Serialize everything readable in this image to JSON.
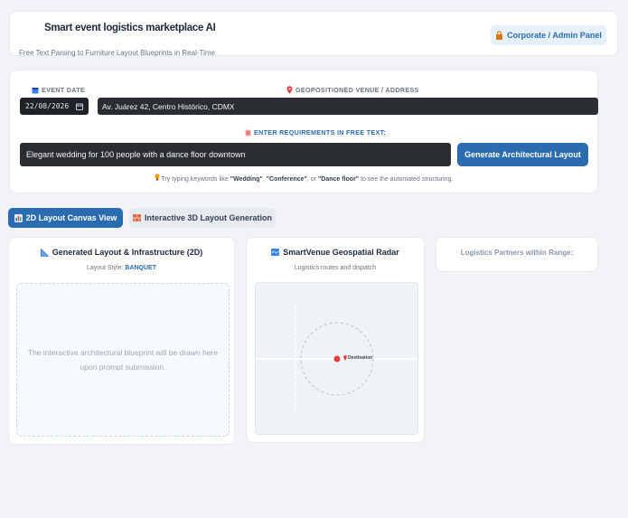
{
  "header": {
    "title": "Smart event logistics marketplace AI",
    "subtitle": "Free Text Parsing to Furniture Layout Blueprints in Real-Time",
    "admin_button": "Corporate / Admin Panel"
  },
  "form": {
    "event_date_label": "EVENT DATE",
    "event_date_value": "22/08/2026",
    "venue_label": "GEOPOSITIONED VENUE / ADDRESS",
    "venue_value": "Av. Juárez 42, Centro Histórico, CDMX",
    "requirements_label": "ENTER REQUIREMENTS IN FREE TEXT:",
    "requirements_value": "Elegant wedding for 100 people with a dance floor downtown",
    "generate_button": "Generate Architectural Layout",
    "hint_prefix": "Try typing keywords like",
    "hint_kw1": "\"Wedding\"",
    "hint_kw2": "\"Conference\"",
    "hint_or": ", or",
    "hint_kw3": "\"Dance floor\"",
    "hint_suffix": "to see the automated structuring."
  },
  "tabs": [
    {
      "label": "2D Layout Canvas View",
      "active": true
    },
    {
      "label": "Interactive 3D Layout Generation",
      "active": false
    }
  ],
  "layout_panel": {
    "title": "Generated Layout & Infrastructure (2D)",
    "style_label": "Layout Style:",
    "style_value": "BANQUET",
    "placeholder": "The interactive architectural blueprint will be drawn here upon prompt submission."
  },
  "radar_panel": {
    "title": "SmartVenue Geospatial Radar",
    "subtitle": "Logistics routes and dispatch",
    "marker_label": "Destination"
  },
  "partners_panel": {
    "title": "Logistics Partners within Range:"
  },
  "colors": {
    "accent": "#2b6cb0",
    "marker": "#e53e3e",
    "input_bg": "#2a2d31"
  }
}
